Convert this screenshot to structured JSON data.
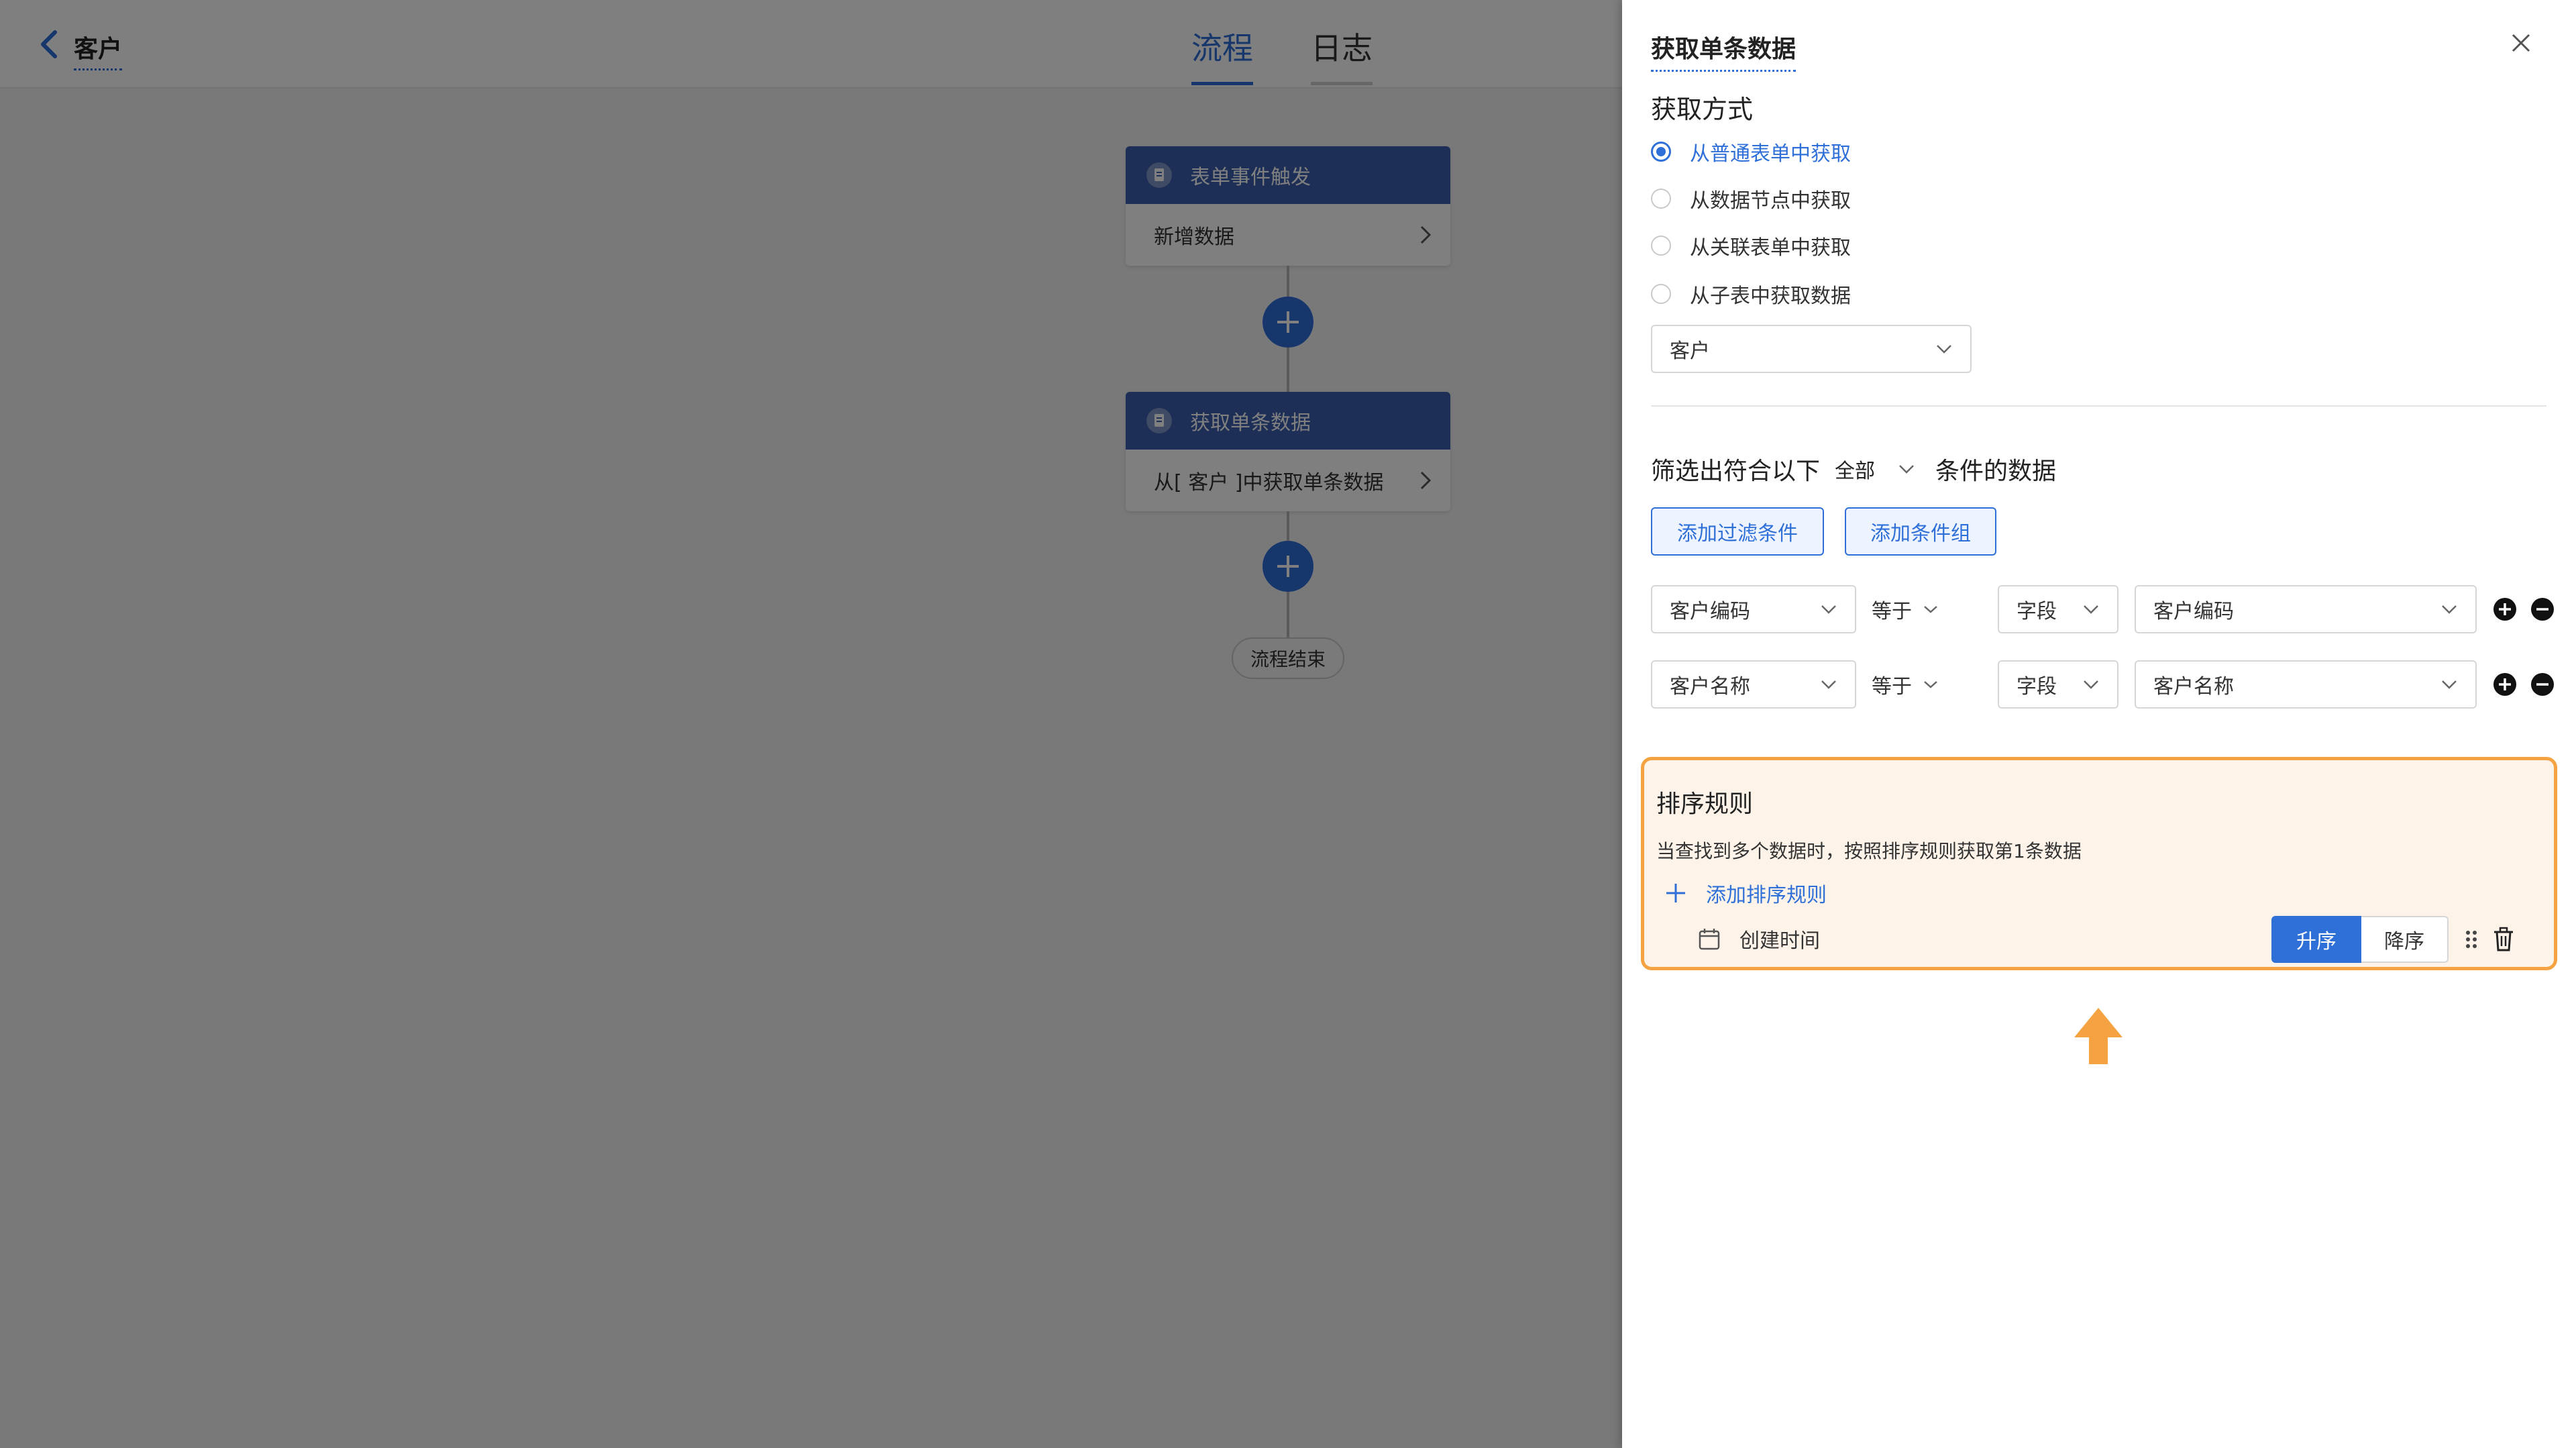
{
  "header": {
    "back_label": "客户",
    "tabs": [
      {
        "label": "流程",
        "active": true
      },
      {
        "label": "日志",
        "active": false
      }
    ]
  },
  "flow": {
    "nodes": [
      {
        "header": "表单事件触发",
        "body": "新增数据"
      },
      {
        "header": "获取单条数据",
        "body": "从[ 客户 ]中获取单条数据"
      }
    ],
    "end_label": "流程结束"
  },
  "drawer": {
    "title": "获取单条数据",
    "source_section": {
      "label": "获取方式",
      "options": [
        {
          "label": "从普通表单中获取",
          "checked": true
        },
        {
          "label": "从数据节点中获取",
          "checked": false
        },
        {
          "label": "从关联表单中获取",
          "checked": false
        },
        {
          "label": "从子表中获取数据",
          "checked": false
        }
      ],
      "form_select": "客户"
    },
    "filter": {
      "prefix": "筛选出符合以下",
      "match": "全部",
      "suffix": "条件的数据",
      "add_condition": "添加过滤条件",
      "add_group": "添加条件组",
      "conditions": [
        {
          "field": "客户编码",
          "operator": "等于",
          "value_type": "字段",
          "value": "客户编码"
        },
        {
          "field": "客户名称",
          "operator": "等于",
          "value_type": "字段",
          "value": "客户名称"
        }
      ]
    },
    "sort": {
      "title": "排序规则",
      "description": "当查找到多个数据时，按照排序规则获取第1条数据",
      "add_label": "添加排序规则",
      "rule_field": "创建时间",
      "asc_label": "升序",
      "desc_label": "降序",
      "selected": "asc"
    }
  },
  "colors": {
    "accent": "#2f6fd8",
    "node_header": "#3a5fae",
    "highlight_border": "#f5a342",
    "highlight_bg": "#fdf3e8",
    "arrow": "#f5a342"
  }
}
